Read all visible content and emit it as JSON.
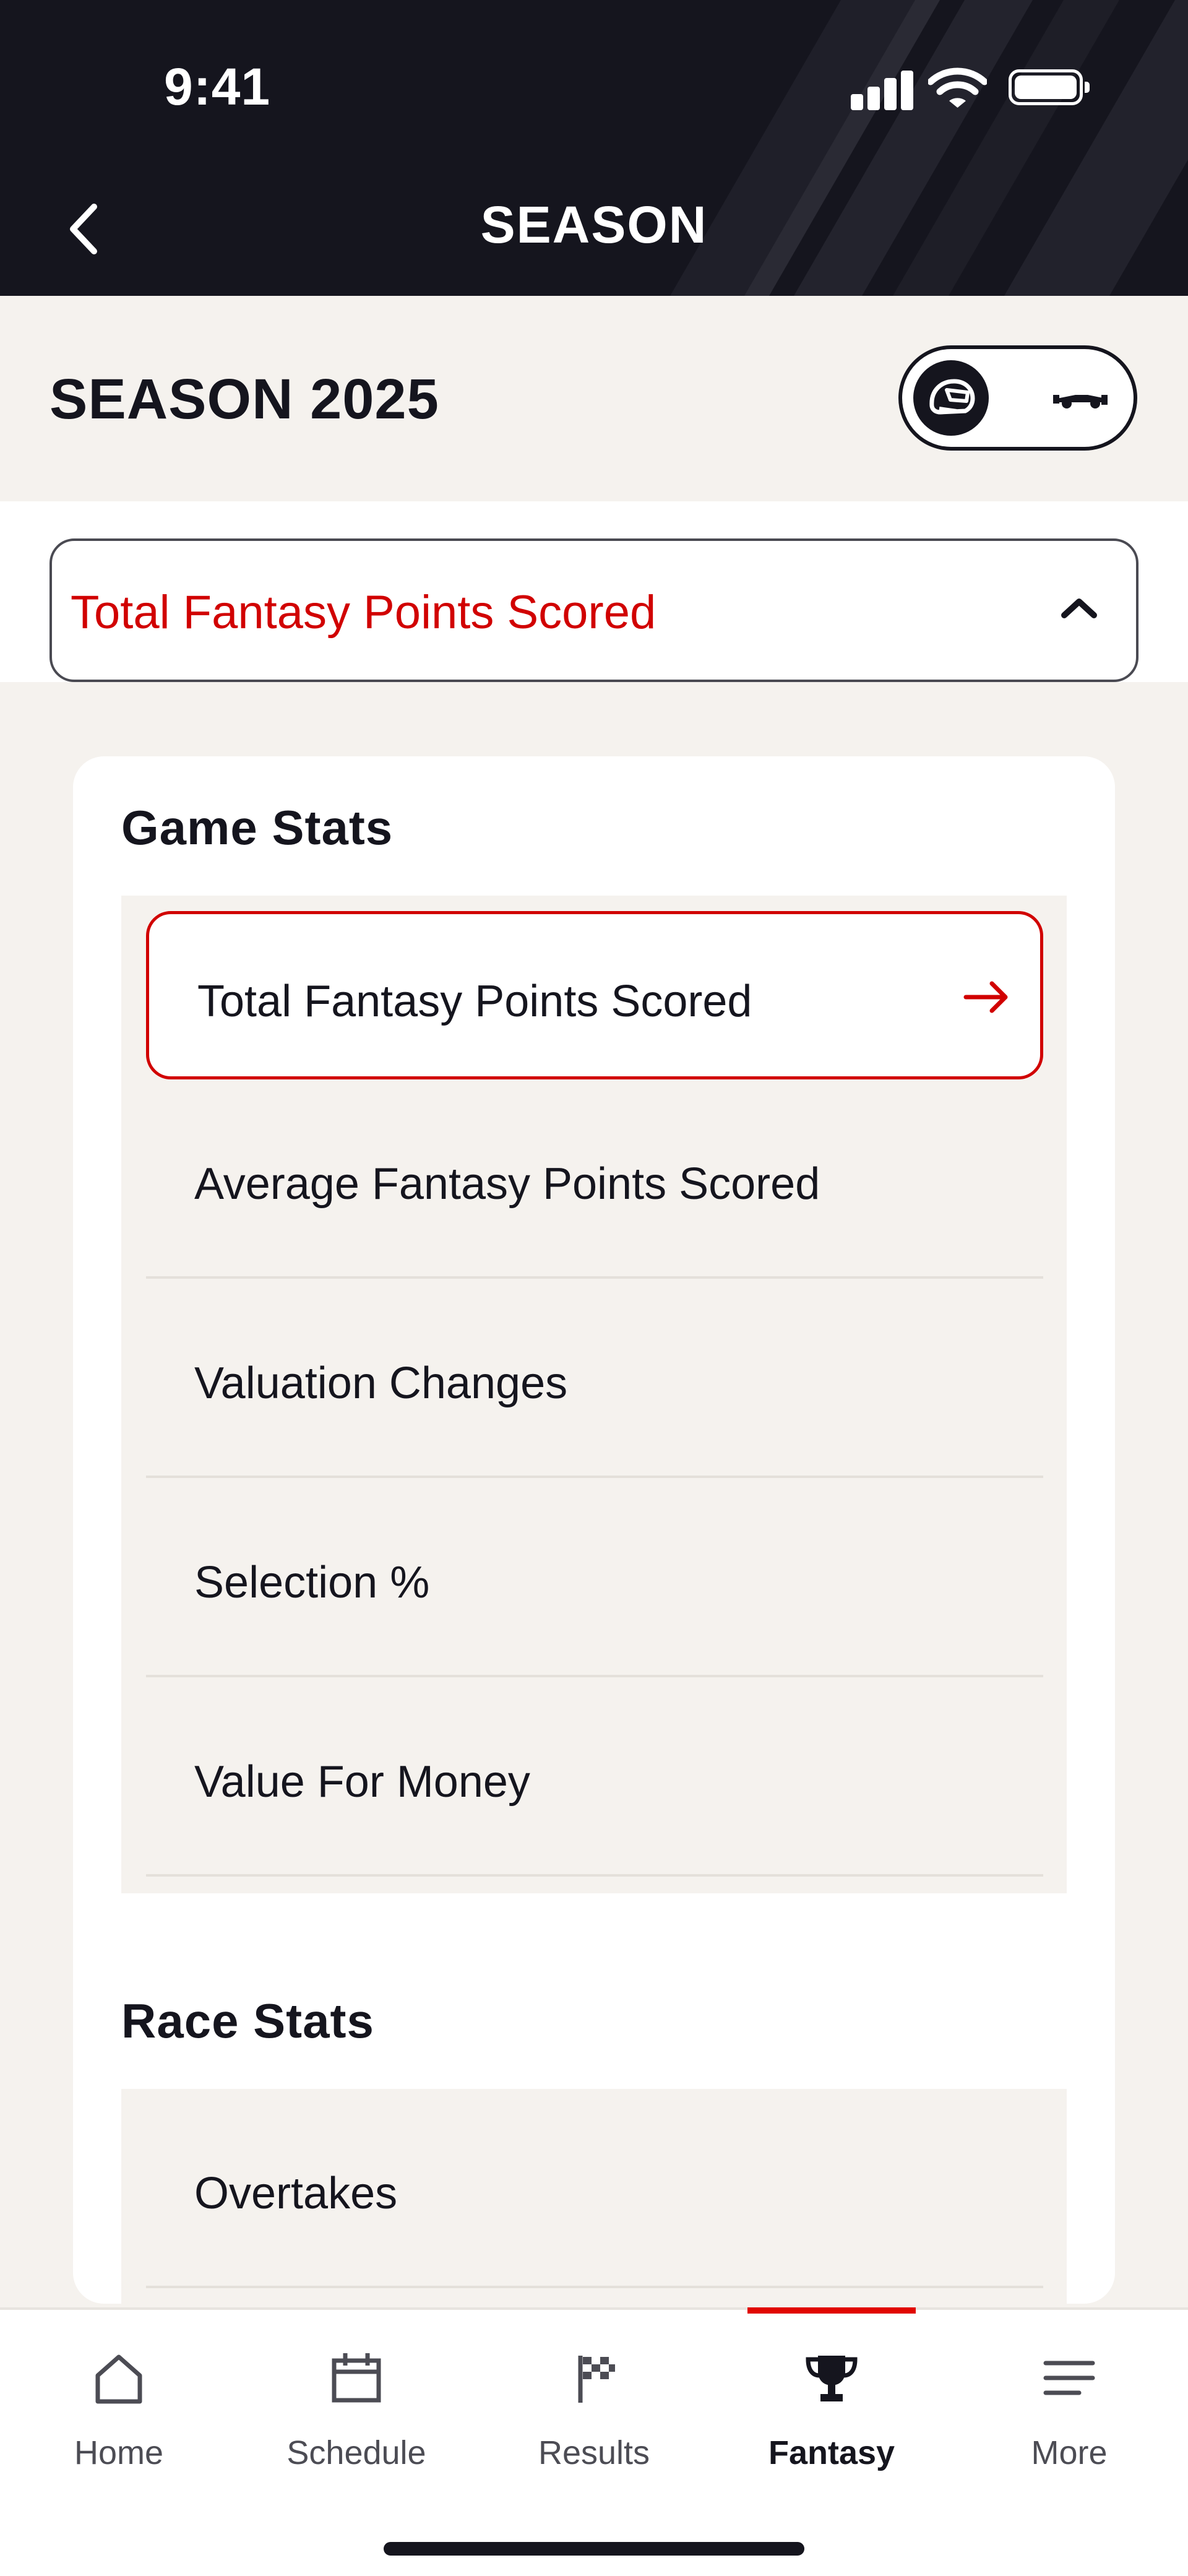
{
  "status_bar": {
    "time": "9:41"
  },
  "header": {
    "title": "SEASON"
  },
  "season": {
    "title": "SEASON 2025"
  },
  "dropdown": {
    "selected": "Total Fantasy Points Scored"
  },
  "game_stats": {
    "heading": "Game Stats",
    "items": [
      {
        "label": "Total Fantasy Points Scored",
        "selected": true
      },
      {
        "label": "Average Fantasy Points Scored"
      },
      {
        "label": "Valuation Changes"
      },
      {
        "label": "Selection %"
      },
      {
        "label": "Value For Money"
      }
    ]
  },
  "race_stats": {
    "heading": "Race Stats",
    "items": [
      {
        "label": "Overtakes"
      }
    ]
  },
  "tabbar": {
    "tabs": [
      {
        "label": "Home",
        "icon": "home-icon"
      },
      {
        "label": "Schedule",
        "icon": "calendar-icon"
      },
      {
        "label": "Results",
        "icon": "checkered-flag-icon"
      },
      {
        "label": "Fantasy",
        "icon": "trophy-icon",
        "active": true
      },
      {
        "label": "More",
        "icon": "menu-icon"
      }
    ]
  },
  "colors": {
    "accent": "#e10600",
    "selected_text": "#d10000",
    "dark": "#15151e",
    "background": "#f5f2ee"
  }
}
